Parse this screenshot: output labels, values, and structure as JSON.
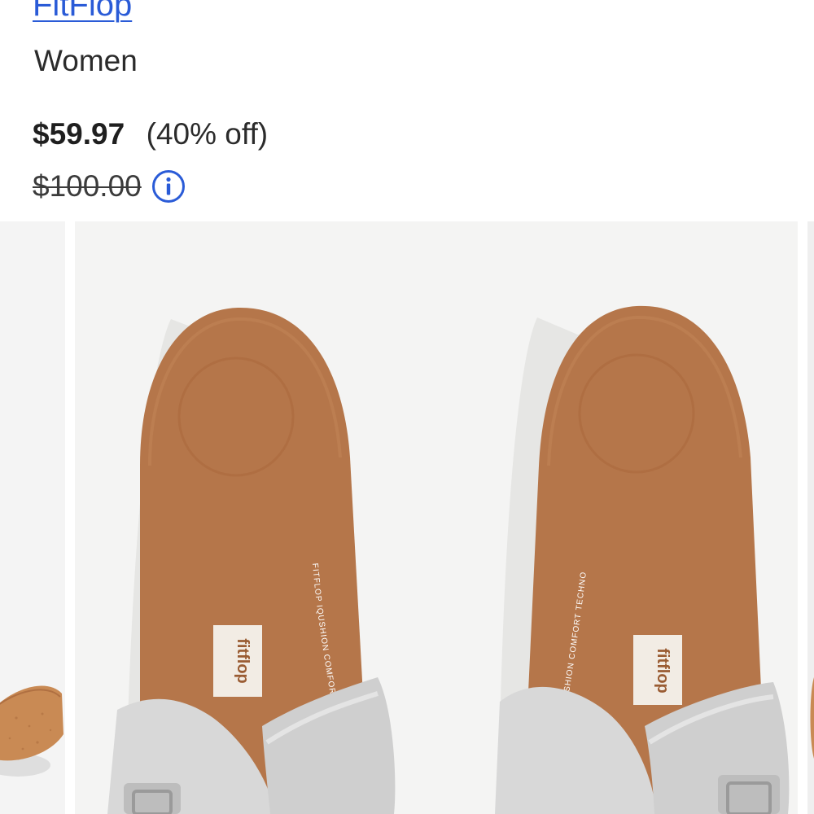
{
  "product": {
    "brand": "FitFlop",
    "category": "Women",
    "sale_price": "$59.97",
    "discount": "(40% off)",
    "original_price": "$100.00",
    "info_icon": "info-icon"
  },
  "gallery": {
    "insole_brand": "fitflop",
    "insole_tagline": "FITFLOP IQUSHION COMFORT TECHNOLOGY",
    "colors": {
      "footbed": "#b5764a",
      "strap": "#d9d9d9",
      "cork": "#c98a54",
      "background": "#f4f4f3"
    }
  },
  "colors": {
    "link": "#2a5bd7",
    "text": "#2b2b2b"
  }
}
